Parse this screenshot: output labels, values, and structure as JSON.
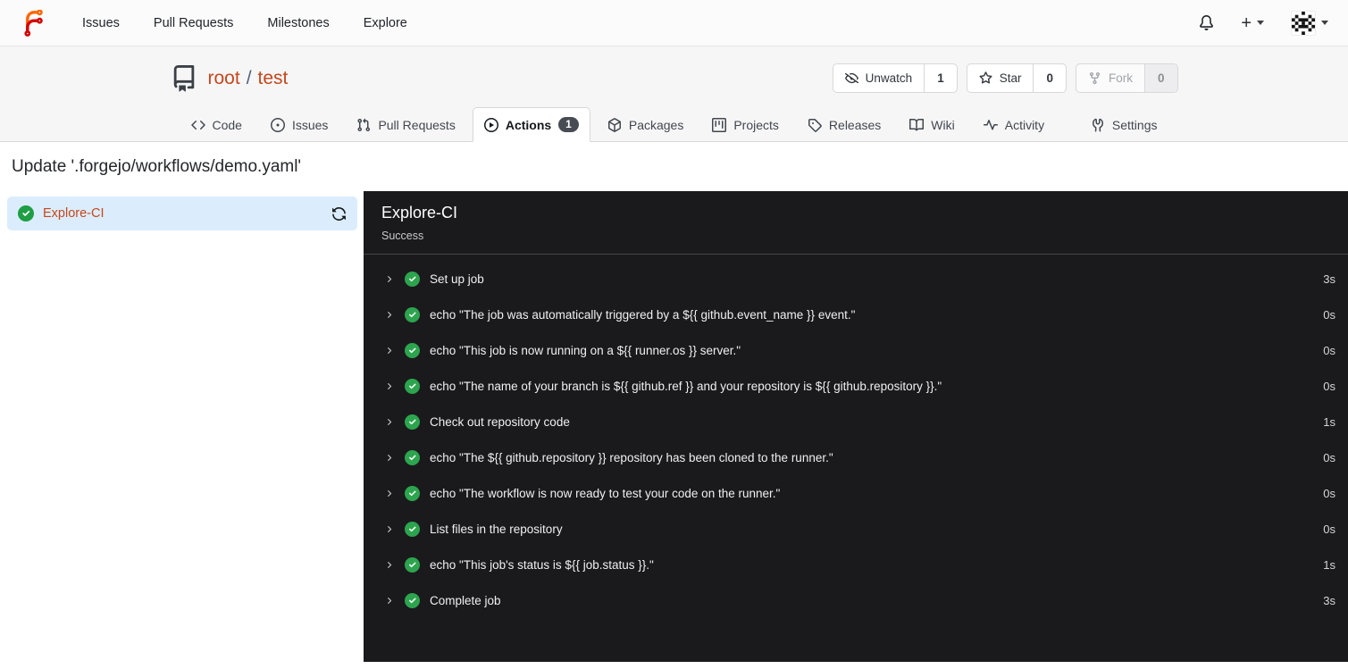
{
  "navbar": {
    "links": [
      {
        "label": "Issues"
      },
      {
        "label": "Pull Requests"
      },
      {
        "label": "Milestones"
      },
      {
        "label": "Explore"
      }
    ],
    "create_label": "+"
  },
  "repo": {
    "owner": "root",
    "separator": "/",
    "name": "test",
    "buttons": {
      "unwatch": {
        "label": "Unwatch",
        "count": "1"
      },
      "star": {
        "label": "Star",
        "count": "0"
      },
      "fork": {
        "label": "Fork",
        "count": "0"
      }
    },
    "tabs": [
      {
        "label": "Code"
      },
      {
        "label": "Issues"
      },
      {
        "label": "Pull Requests"
      },
      {
        "label": "Actions",
        "badge": "1",
        "active": true
      },
      {
        "label": "Packages"
      },
      {
        "label": "Projects"
      },
      {
        "label": "Releases"
      },
      {
        "label": "Wiki"
      },
      {
        "label": "Activity"
      },
      {
        "label": "Settings"
      }
    ]
  },
  "run": {
    "title": "Update '.forgejo/workflows/demo.yaml'",
    "job": {
      "name": "Explore-CI",
      "status": "success"
    },
    "panel": {
      "title": "Explore-CI",
      "status": "Success"
    },
    "steps": [
      {
        "name": "Set up job",
        "duration": "3s"
      },
      {
        "name": "echo \"The job was automatically triggered by a ${{ github.event_name }} event.\"",
        "duration": "0s"
      },
      {
        "name": "echo \"This job is now running on a ${{ runner.os }} server.\"",
        "duration": "0s"
      },
      {
        "name": "echo \"The name of your branch is ${{ github.ref }} and your repository is ${{ github.repository }}.\"",
        "duration": "0s"
      },
      {
        "name": "Check out repository code",
        "duration": "1s"
      },
      {
        "name": "echo \"The ${{ github.repository }} repository has been cloned to the runner.\"",
        "duration": "0s"
      },
      {
        "name": "echo \"The workflow is now ready to test your code on the runner.\"",
        "duration": "0s"
      },
      {
        "name": "List files in the repository",
        "duration": "0s"
      },
      {
        "name": "echo \"This job's status is ${{ job.status }}.\"",
        "duration": "1s"
      },
      {
        "name": "Complete job",
        "duration": "3s"
      }
    ]
  },
  "colors": {
    "link_accent": "#c5471d",
    "success_green": "#2da44e",
    "selected_job_bg": "#dbedfc",
    "panel_bg": "#1a1a1c",
    "badge_bg": "#474c54"
  }
}
